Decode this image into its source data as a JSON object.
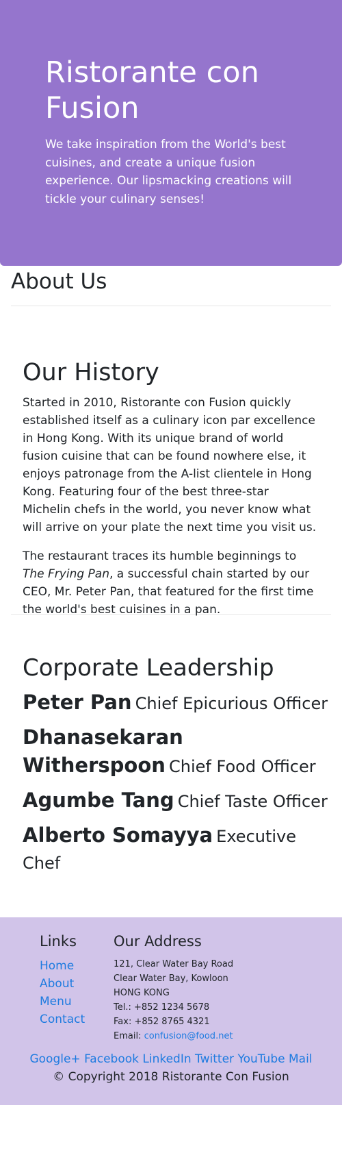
{
  "jumbotron": {
    "title": "Ristorante con Fusion",
    "tagline": "We take inspiration from the World's best cuisines, and create a unique fusion experience. Our lipsmacking creations will tickle your culinary senses!"
  },
  "about": {
    "heading": "About Us"
  },
  "history": {
    "heading": "Our History",
    "para1": "Started in 2010, Ristorante con Fusion quickly established itself as a culinary icon par excellence in Hong Kong. With its unique brand of world fusion cuisine that can be found nowhere else, it enjoys patronage from the A-list clientele in Hong Kong. Featuring four of the best three-star Michelin chefs in the world, you never know what will arrive on your plate the next time you visit us.",
    "para2_pre": "The restaurant traces its humble beginnings to ",
    "para2_em": "The Frying Pan",
    "para2_post": ", a successful chain started by our CEO, Mr. Peter Pan, that featured for the first time the world's best cuisines in a pan."
  },
  "leadership": {
    "heading": "Corporate Leadership",
    "leaders": [
      {
        "name": "Peter Pan",
        "role": "Chief Epicurious Officer"
      },
      {
        "name": "Dhanasekaran Witherspoon",
        "role": "Chief Food Officer"
      },
      {
        "name": "Agumbe Tang",
        "role": "Chief Taste Officer"
      },
      {
        "name": "Alberto Somayya",
        "role": "Executive Chef"
      }
    ]
  },
  "footer": {
    "links_heading": "Links",
    "links": [
      "Home",
      "About",
      "Menu",
      "Contact"
    ],
    "address_heading": "Our Address",
    "address_lines": [
      "121, Clear Water Bay Road",
      "Clear Water Bay, Kowloon",
      "HONG KONG"
    ],
    "tel": "Tel.: +852 1234 5678",
    "fax": "Fax: +852 8765 4321",
    "email_label": "Email: ",
    "email": "confusion@food.net",
    "social": [
      "Google+",
      "Facebook",
      "LinkedIn",
      "Twitter",
      "YouTube",
      "Mail"
    ],
    "copyright": "© Copyright 2018 Ristorante Con Fusion"
  },
  "colors": {
    "jumbotron_bg": "#9575cd",
    "footer_bg": "#d1c4e9",
    "link": "#1e7be0"
  }
}
